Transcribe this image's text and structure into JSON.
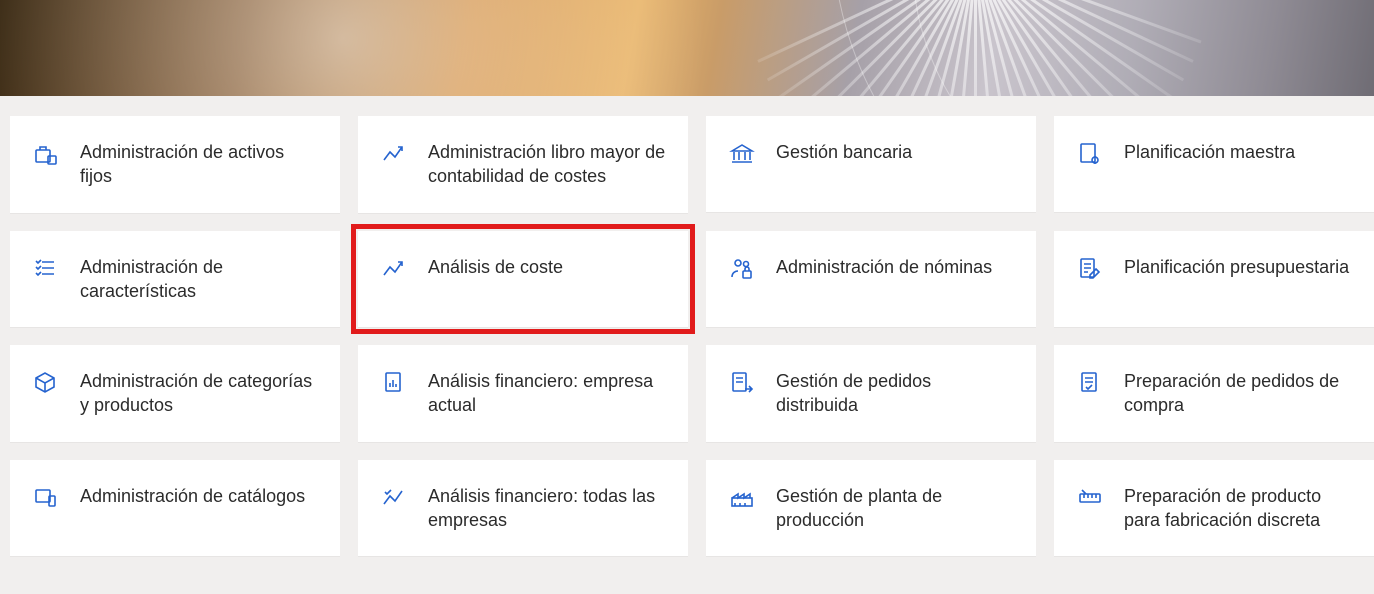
{
  "highlighted_index": 5,
  "cards": [
    {
      "label": "Administración de activos fijos",
      "icon": "assets-icon"
    },
    {
      "label": "Administración libro mayor de contabilidad de costes",
      "icon": "chart-up-icon"
    },
    {
      "label": "Gestión bancaria",
      "icon": "bank-icon"
    },
    {
      "label": "Planificación maestra",
      "icon": "doc-gear-icon"
    },
    {
      "label": "Administración de características",
      "icon": "checklist-icon"
    },
    {
      "label": "Análisis de coste",
      "icon": "chart-up-icon"
    },
    {
      "label": "Administración de nóminas",
      "icon": "people-lock-icon"
    },
    {
      "label": "Planificación presupuestaria",
      "icon": "doc-pencil-icon"
    },
    {
      "label": "Administración de categorías y productos",
      "icon": "box-icon"
    },
    {
      "label": "Análisis financiero: empresa actual",
      "icon": "doc-bar-icon"
    },
    {
      "label": "Gestión de pedidos distribuida",
      "icon": "doc-arrow-icon"
    },
    {
      "label": "Preparación de pedidos de compra",
      "icon": "doc-check-icon"
    },
    {
      "label": "Administración de catálogos",
      "icon": "device-icon"
    },
    {
      "label": "Análisis financiero: todas las empresas",
      "icon": "chart-check-icon"
    },
    {
      "label": "Gestión de planta de producción",
      "icon": "factory-icon"
    },
    {
      "label": "Preparación de producto para fabricación discreta",
      "icon": "ruler-icon"
    }
  ]
}
